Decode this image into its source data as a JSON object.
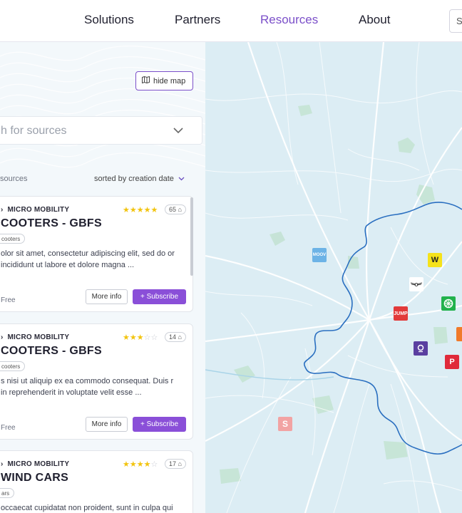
{
  "nav": {
    "links": [
      "Solutions",
      "Partners",
      "Resources",
      "About"
    ],
    "active": "Resources",
    "search_placeholder": "S"
  },
  "sidebar": {
    "hide_map_label": "hide map",
    "search_placeholder": "h for sources",
    "results_label": "sources",
    "sort_label": "sorted by creation date"
  },
  "cards": [
    {
      "category": "MICRO MOBILITY",
      "title": "COOTERS - GBFS",
      "tag": "cooters",
      "rating": 5,
      "count": "65",
      "description": "olor sit amet, consectetur adipiscing elit, sed do or incididunt ut labore et dolore magna ...",
      "price": "Free",
      "more_label": "More info",
      "subscribe_label": "+ Subscribe"
    },
    {
      "category": "MICRO MOBILITY",
      "title": "COOTERS - GBFS",
      "tag": "cooters",
      "rating": 3,
      "count": "14",
      "description": "s nisi ut aliquip ex ea commodo consequat. Duis r in reprehenderit in voluptate velit esse ...",
      "price": "Free",
      "more_label": "More info",
      "subscribe_label": "+ Subscribe"
    },
    {
      "category": "MICRO MOBILITY",
      "title": "WIND CARS",
      "tag": "ars",
      "rating": 4,
      "count": "17",
      "description": "occaecat cupidatat non proident, sunt in culpa qui",
      "price": "",
      "more_label": "",
      "subscribe_label": ""
    }
  ],
  "map": {
    "markers": [
      {
        "name": "marker-blue-operator",
        "label": "MOOV",
        "color": "#6db3e6"
      },
      {
        "name": "marker-yellow-operator",
        "label": "W",
        "color": "#f5e21a"
      },
      {
        "name": "marker-winged-logo",
        "label": "",
        "color": "#ffffff"
      },
      {
        "name": "marker-green-operator",
        "label": "",
        "color": "#22b24c"
      },
      {
        "name": "marker-jump",
        "label": "JUMP",
        "color": "#e23a3a"
      },
      {
        "name": "marker-orange-operator",
        "label": "",
        "color": "#f07a2a"
      },
      {
        "name": "marker-purple-operator",
        "label": "",
        "color": "#5a3fa0"
      },
      {
        "name": "marker-red-p-operator",
        "label": "P",
        "color": "#e02a3a"
      },
      {
        "name": "marker-pink-operator",
        "label": "S",
        "color": "#f2a3a3"
      }
    ]
  }
}
